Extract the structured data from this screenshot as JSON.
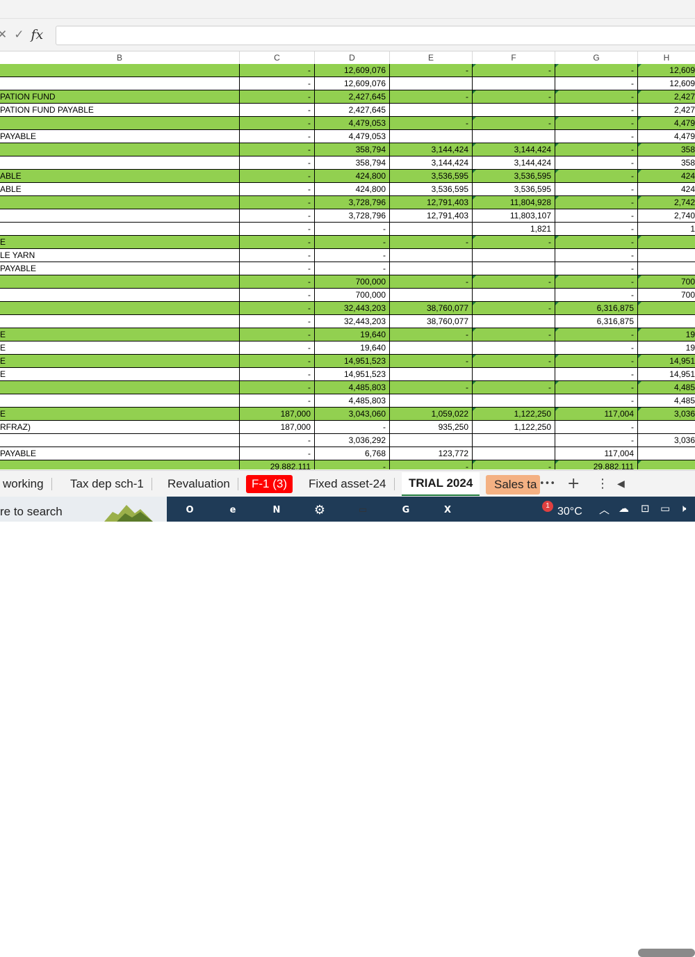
{
  "formula_bar": {
    "cancel_icon": "✕",
    "enter_icon": "✓",
    "fx_label": "fx",
    "value": ""
  },
  "columns": [
    "B",
    "C",
    "D",
    "E",
    "F",
    "G",
    "H"
  ],
  "rows": [
    {
      "g": true,
      "B": "",
      "C": "-",
      "D": "12,609,076",
      "E": "-",
      "F": "-",
      "G": "-",
      "H": "12,609"
    },
    {
      "g": false,
      "B": "",
      "C": "-",
      "D": "12,609,076",
      "E": "",
      "F": "",
      "G": "-",
      "H": "12,609"
    },
    {
      "g": true,
      "B": "PATION FUND",
      "C": "-",
      "D": "2,427,645",
      "E": "-",
      "F": "-",
      "G": "-",
      "H": "2,427"
    },
    {
      "g": false,
      "B": "PATION FUND PAYABLE",
      "C": "-",
      "D": "2,427,645",
      "E": "",
      "F": "",
      "G": "-",
      "H": "2,427"
    },
    {
      "g": true,
      "B": "",
      "C": "-",
      "D": "4,479,053",
      "E": "-",
      "F": "-",
      "G": "-",
      "H": "4,479"
    },
    {
      "g": false,
      "B": " PAYABLE",
      "C": "-",
      "D": "4,479,053",
      "E": "",
      "F": "",
      "G": "-",
      "H": "4,479"
    },
    {
      "g": true,
      "B": "",
      "C": "-",
      "D": "358,794",
      "E": "3,144,424",
      "F": "3,144,424",
      "G": "-",
      "H": "358"
    },
    {
      "g": false,
      "B": "",
      "C": "-",
      "D": "358,794",
      "E": "3,144,424",
      "F": "3,144,424",
      "G": "-",
      "H": "358"
    },
    {
      "g": true,
      "B": "ABLE",
      "C": "-",
      "D": "424,800",
      "E": "3,536,595",
      "F": "3,536,595",
      "G": "-",
      "H": "424"
    },
    {
      "g": false,
      "B": "ABLE",
      "C": "-",
      "D": "424,800",
      "E": "3,536,595",
      "F": "3,536,595",
      "G": "-",
      "H": "424"
    },
    {
      "g": true,
      "B": "",
      "C": "-",
      "D": "3,728,796",
      "E": "12,791,403",
      "F": "11,804,928",
      "G": "-",
      "H": "2,742"
    },
    {
      "g": false,
      "B": "",
      "C": "-",
      "D": "3,728,796",
      "E": "12,791,403",
      "F": "11,803,107",
      "G": "-",
      "H": "2,740"
    },
    {
      "g": false,
      "B": "",
      "C": "-",
      "D": "-",
      "E": "",
      "F": "1,821",
      "G": "-",
      "H": "1"
    },
    {
      "g": true,
      "B": "E",
      "C": "-",
      "D": "-",
      "E": "-",
      "F": "-",
      "G": "-",
      "H": ""
    },
    {
      "g": false,
      "B": "LE YARN",
      "C": "-",
      "D": "-",
      "E": "",
      "F": "",
      "G": "-",
      "H": ""
    },
    {
      "g": false,
      "B": "PAYABLE",
      "C": "-",
      "D": "-",
      "E": "",
      "F": "",
      "G": "-",
      "H": ""
    },
    {
      "g": true,
      "B": "",
      "C": "-",
      "D": "700,000",
      "E": "-",
      "F": "-",
      "G": "-",
      "H": "700"
    },
    {
      "g": false,
      "B": "",
      "C": "-",
      "D": "700,000",
      "E": "",
      "F": "",
      "G": "-",
      "H": "700"
    },
    {
      "g": true,
      "B": "",
      "C": "-",
      "D": "32,443,203",
      "E": "38,760,077",
      "F": "-",
      "G": "6,316,875",
      "H": ""
    },
    {
      "g": false,
      "B": "",
      "C": "-",
      "D": "32,443,203",
      "E": "38,760,077",
      "F": "",
      "G": "6,316,875",
      "H": ""
    },
    {
      "g": true,
      "B": "E",
      "C": "-",
      "D": "19,640",
      "E": "-",
      "F": "-",
      "G": "-",
      "H": "19"
    },
    {
      "g": false,
      "B": "E",
      "C": "-",
      "D": "19,640",
      "E": "",
      "F": "",
      "G": "-",
      "H": "19"
    },
    {
      "g": true,
      "B": "E",
      "C": "-",
      "D": "14,951,523",
      "E": "-",
      "F": "-",
      "G": "-",
      "H": "14,951"
    },
    {
      "g": false,
      "B": "E",
      "C": "-",
      "D": "14,951,523",
      "E": "",
      "F": "",
      "G": "-",
      "H": "14,951"
    },
    {
      "g": true,
      "B": "",
      "C": "-",
      "D": "4,485,803",
      "E": "-",
      "F": "-",
      "G": "-",
      "H": "4,485"
    },
    {
      "g": false,
      "B": "",
      "C": "-",
      "D": "4,485,803",
      "E": "",
      "F": "",
      "G": "-",
      "H": "4,485"
    },
    {
      "g": true,
      "B": "E",
      "C": "187,000",
      "D": "3,043,060",
      "E": "1,059,022",
      "F": "1,122,250",
      "G": "117,004",
      "H": "3,036"
    },
    {
      "g": false,
      "B": "RFRAZ)",
      "C": "187,000",
      "D": "-",
      "E": "935,250",
      "F": "1,122,250",
      "G": "-",
      "H": ""
    },
    {
      "g": false,
      "B": "",
      "C": "-",
      "D": "3,036,292",
      "E": "",
      "F": "",
      "G": "-",
      "H": "3,036"
    },
    {
      "g": false,
      "B": " PAYABLE",
      "C": "-",
      "D": "6,768",
      "E": "123,772",
      "F": "",
      "G": "117,004",
      "H": ""
    },
    {
      "g": true,
      "B": "",
      "C": "29,882,111",
      "D": "-",
      "E": "-",
      "F": "-",
      "G": "29,882,111",
      "H": ""
    }
  ],
  "sheet_tabs": {
    "t1": "working",
    "t2": "Tax dep sch-1",
    "t3": "Revaluation",
    "t4": "F-1 (3)",
    "t5": "Fixed asset-24",
    "t6": "TRIAL 2024",
    "t7": "Sales ta",
    "more_icon": "•••",
    "add_icon": "+",
    "menu_icon": "⋮",
    "scroll_left_icon": "◀"
  },
  "taskbar": {
    "search_text": "re to search",
    "apps": [
      {
        "label": "O",
        "color": "#0f6cbd"
      },
      {
        "label": "e",
        "color": "#1aa3d9"
      },
      {
        "label": "N",
        "color": "#7719aa"
      },
      {
        "label": "⚙",
        "color": "#1f3b57"
      },
      {
        "label": "▭",
        "color": "#f2c14e"
      },
      {
        "label": "G",
        "color": "#34a853"
      },
      {
        "label": "X",
        "color": "#107c41"
      }
    ],
    "badge": "1",
    "temperature": "30°C",
    "chevron_icon": "︿",
    "cloud_icon": "☁",
    "net_icon": "⊡",
    "battery_icon": "▭",
    "volume_icon": "🕨"
  },
  "colors": {
    "green_fill": "#92d050",
    "active_tab_underline": "#1e7a3c",
    "red_tab": "#ff0000",
    "orange_tab": "#f4b183"
  }
}
